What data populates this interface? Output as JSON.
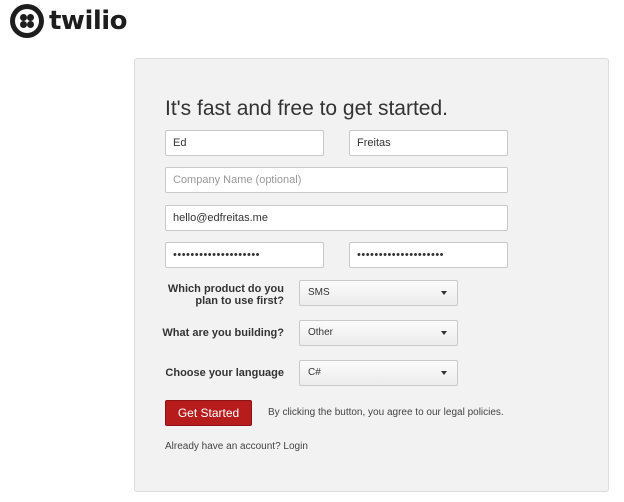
{
  "brand": {
    "name": "twilio",
    "logo_icon": "twilio-logo-icon"
  },
  "form": {
    "heading": "It's fast and free to get started.",
    "first_name": {
      "value": "Ed"
    },
    "last_name": {
      "value": "Freitas"
    },
    "company": {
      "value": "",
      "placeholder": "Company Name (optional)"
    },
    "email": {
      "value": "hello@edfreitas.me"
    },
    "password": {
      "value": "••••••••••••••••••••"
    },
    "password_confirm": {
      "value": "••••••••••••••••••••"
    },
    "product": {
      "label_line1": "Which product do you",
      "label_line2": "plan to use first?",
      "selected": "SMS"
    },
    "building": {
      "label": "What are you building?",
      "selected": "Other"
    },
    "language": {
      "label": "Choose your language",
      "selected": "C#"
    },
    "submit_label": "Get Started",
    "legal_text": "By clicking the button, you agree to our legal policies.",
    "account_prompt": "Already have an account?",
    "login_link": "Login"
  },
  "colors": {
    "button": "#b71c1c",
    "panel": "#f2f2f2",
    "logo": "#1d1d1d"
  }
}
